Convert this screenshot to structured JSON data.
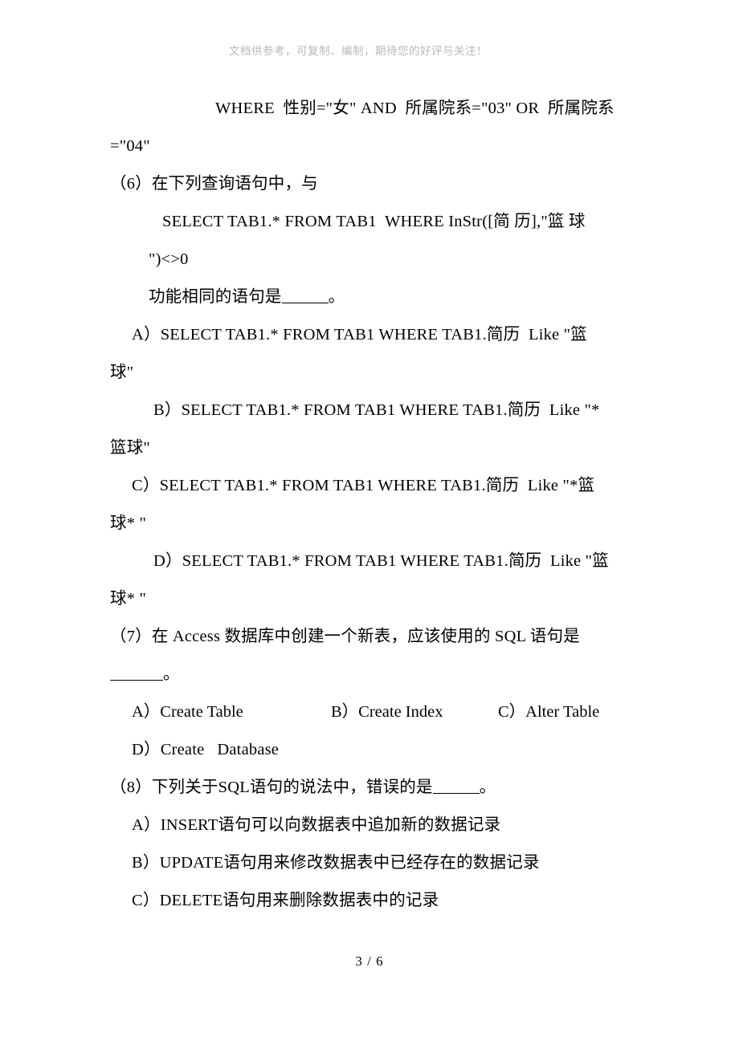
{
  "header": {
    "note": "文档供参考，可复制、编制，期待您的好评与关注！"
  },
  "content": {
    "carry_over_line_1": "WHERE  性别=\"女\" AND  所属院系=\"03\" OR  所属院系",
    "carry_over_line_2": "=\"04\"",
    "q6": {
      "stem": "（6）在下列查询语句中，与",
      "sql_line_1": "SELECT TAB1.* FROM TAB1  WHERE InStr([简 历],\"篮 球",
      "sql_line_2": "\")<>0",
      "stem_tail_before_blank": "功能相同的语句是",
      "stem_tail_after_blank": "。",
      "options": [
        {
          "line1": "A）SELECT TAB1.* FROM TAB1 WHERE TAB1.简历  Like \"篮",
          "line2": "球\""
        },
        {
          "line1": "B）SELECT TAB1.* FROM TAB1 WHERE TAB1.简历  Like \"*",
          "line2": "篮球\""
        },
        {
          "line1": "C）SELECT TAB1.* FROM TAB1 WHERE TAB1.简历  Like \"*篮",
          "line2": "球* \""
        },
        {
          "line1": "D）SELECT TAB1.* FROM TAB1 WHERE TAB1.简历  Like \"篮",
          "line2": "球* \""
        }
      ]
    },
    "q7": {
      "stem_line_1": "（7）在 Access 数据库中创建一个新表，应该使用的 SQL 语句是",
      "stem_line_2_after_blank": "。",
      "options": [
        "A）Create Table",
        "B）Create Index",
        "C）Alter Table",
        "D）Create   Database"
      ]
    },
    "q8": {
      "stem_before_blank": "（8）下列关于SQL语句的说法中，错误的是",
      "stem_after_blank": "。",
      "options": [
        "A）INSERT语句可以向数据表中追加新的数据记录",
        "B）UPDATE语句用来修改数据表中已经存在的数据记录",
        "C）DELETE语句用来删除数据表中的记录"
      ]
    }
  },
  "footer": {
    "page_indicator": "3 / 6"
  }
}
